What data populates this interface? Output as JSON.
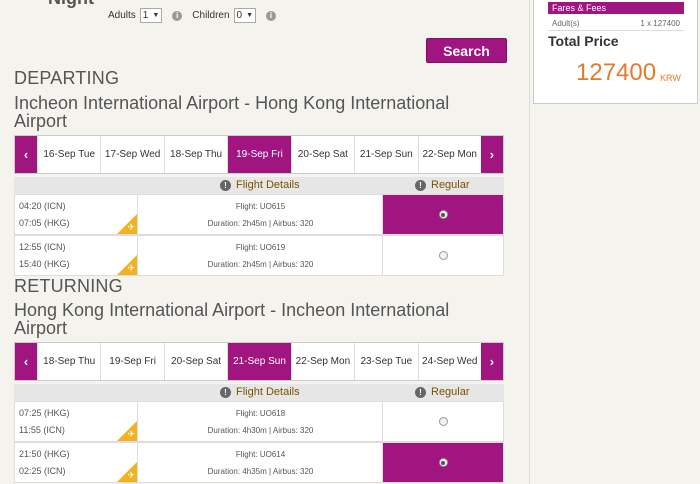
{
  "header": {
    "partial_title": "Night",
    "adults_label": "Adults",
    "adults_value": "1",
    "children_label": "Children",
    "children_value": "0",
    "search_label": "Search"
  },
  "summary": {
    "fares_label": "Fares & Fees",
    "adult_label": "Adult(s)",
    "adult_value": "1 x 127400",
    "total_label": "Total Price",
    "total_amount": "127400",
    "currency": "KRW"
  },
  "departing": {
    "heading": "DEPARTING",
    "route": "Incheon International Airport - Hong Kong International Airport",
    "dates": [
      "16-Sep Tue",
      "17-Sep Wed",
      "18-Sep Thu",
      "19-Sep Fri",
      "20-Sep Sat",
      "21-Sep Sun",
      "22-Sep Mon"
    ],
    "active_date": "19-Sep Fri",
    "col_details": "Flight Details",
    "col_fare": "Regular",
    "flights": [
      {
        "depart": "04:20 (ICN)",
        "arrive": "07:05 (HKG)",
        "flight": "Flight: UO615",
        "duration": "Duration: 2h45m | Airbus: 320",
        "selected": true
      },
      {
        "depart": "12:55 (ICN)",
        "arrive": "15:40 (HKG)",
        "flight": "Flight: UO619",
        "duration": "Duration: 2h45m | Airbus: 320",
        "selected": false
      }
    ]
  },
  "returning": {
    "heading": "RETURNING",
    "route": "Hong Kong International Airport - Incheon International Airport",
    "dates": [
      "18-Sep Thu",
      "19-Sep Fri",
      "20-Sep Sat",
      "21-Sep Sun",
      "22-Sep Mon",
      "23-Sep Tue",
      "24-Sep Wed"
    ],
    "active_date": "21-Sep Sun",
    "col_details": "Flight Details",
    "col_fare": "Regular",
    "flights": [
      {
        "depart": "07:25 (HKG)",
        "arrive": "11:55 (ICN)",
        "flight": "Flight: UO618",
        "duration": "Duration: 4h30m | Airbus: 320",
        "selected": false
      },
      {
        "depart": "21:50 (HKG)",
        "arrive": "02:25 (ICN)",
        "flight": "Flight: UO614",
        "duration": "Duration: 4h35m | Airbus: 320",
        "selected": true
      }
    ]
  },
  "icons": {
    "prev": "chevron-left-icon",
    "next": "chevron-right-icon",
    "info": "info-icon",
    "plane": "plane-icon"
  },
  "colors": {
    "brand": "#a0157f",
    "price": "#e27c2c",
    "plane_badge": "#f2b21f"
  }
}
